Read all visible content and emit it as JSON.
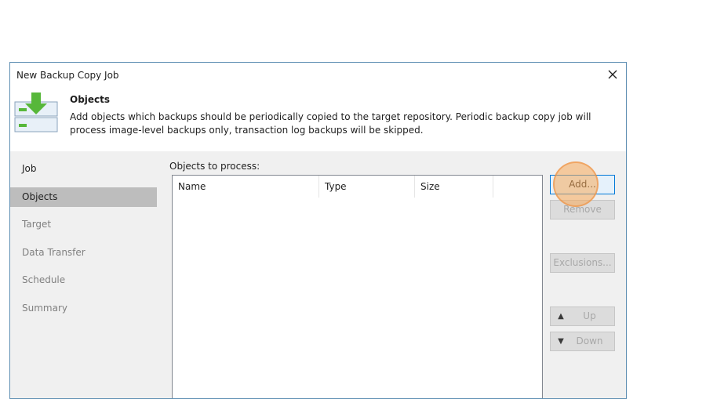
{
  "window": {
    "title": "New Backup Copy Job",
    "close_icon": "close-icon"
  },
  "header": {
    "title": "Objects",
    "description": "Add objects which backups should be periodically copied to the target repository. Periodic backup copy job will process image-level backups only, transaction log backups will be skipped.",
    "icon": "backup-copy-icon",
    "accent_color": "#57b73a"
  },
  "nav": {
    "items": [
      {
        "label": "Job",
        "state": "done"
      },
      {
        "label": "Objects",
        "state": "active"
      },
      {
        "label": "Target",
        "state": "pending"
      },
      {
        "label": "Data Transfer",
        "state": "pending"
      },
      {
        "label": "Schedule",
        "state": "pending"
      },
      {
        "label": "Summary",
        "state": "pending"
      }
    ]
  },
  "objects": {
    "label": "Objects to process:",
    "columns": [
      "Name",
      "Type",
      "Size"
    ],
    "rows": []
  },
  "buttons": {
    "add": "Add...",
    "remove": "Remove",
    "exclusions": "Exclusions...",
    "up": "Up",
    "down": "Down"
  }
}
